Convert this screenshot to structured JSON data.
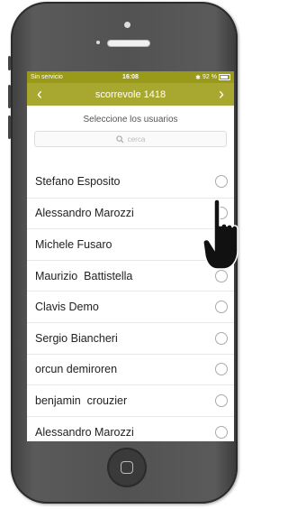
{
  "statusbar": {
    "carrier": "Sin servicio",
    "time": "16:08",
    "battery": "92 %"
  },
  "navbar": {
    "title": "scorrevole 1418",
    "back_icon": "chevron-left-icon",
    "forward_icon": "chevron-right-icon"
  },
  "subtitle": "Seleccione los usuarios",
  "search": {
    "placeholder": "cerca"
  },
  "users": [
    {
      "name": "Stefano Esposito"
    },
    {
      "name": "Alessandro Marozzi"
    },
    {
      "name": "Michele Fusaro"
    },
    {
      "name": "Maurizio  Battistella"
    },
    {
      "name": "Clavis Demo"
    },
    {
      "name": "Sergio Biancheri"
    },
    {
      "name": "orcun demiroren"
    },
    {
      "name": "benjamin  crouzier"
    },
    {
      "name": "Alessandro Marozzi"
    }
  ],
  "colors": {
    "navbar": "#a8a830",
    "statusbar": "#9a9a1a"
  }
}
